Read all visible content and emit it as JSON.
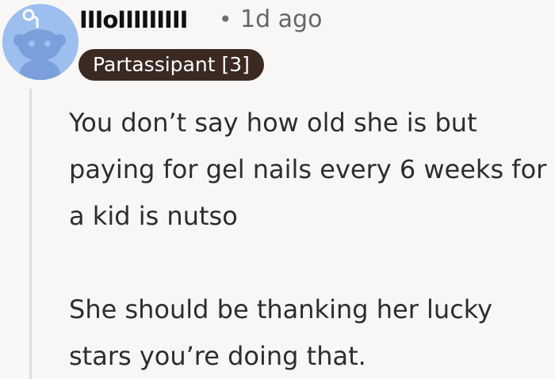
{
  "comment": {
    "author": "IIIoIIIIIIIII",
    "separator": "•",
    "timestamp": "1d ago",
    "flair": "Partassipant [3]",
    "avatar_icon": "reddit-snoo-icon",
    "paragraphs": [
      "You don’t say how old she is but paying for gel nails every 6 weeks for a kid is nutso",
      "She should be thanking her lucky stars you’re doing that."
    ]
  },
  "colors": {
    "background": "#f8f7f5",
    "avatar_bg": "#9cbff0",
    "flair_bg": "#3b2a22",
    "flair_text": "#ffffff",
    "meta_text": "#666666"
  }
}
